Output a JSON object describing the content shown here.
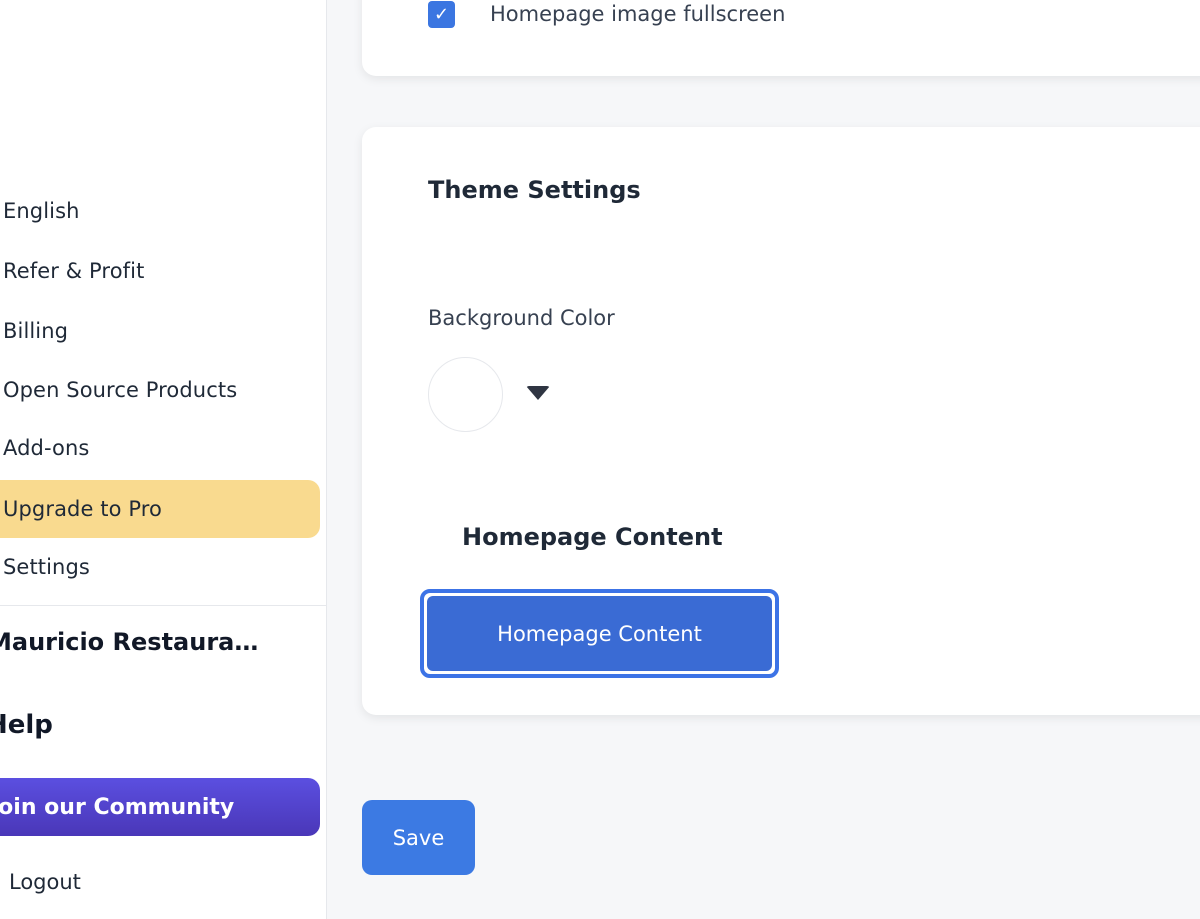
{
  "sidebar": {
    "items": [
      {
        "label": "English"
      },
      {
        "label": "Refer & Profit"
      },
      {
        "label": "Billing"
      },
      {
        "label": "Open Source Products"
      },
      {
        "label": "Add-ons"
      },
      {
        "label": "Upgrade to Pro"
      },
      {
        "label": "Settings"
      }
    ],
    "workspace_name": "Mauricio Restaura…",
    "help_title": "Help",
    "community_label": "Join our Community",
    "logout_label": "Logout",
    "highlight_color": "#f9da8f",
    "community_color": "#5b4fe0"
  },
  "main": {
    "fullscreen_option": {
      "label": "Homepage image fullscreen",
      "checked": true
    },
    "theme_settings": {
      "title": "Theme Settings",
      "background_color_label": "Background Color",
      "background_color_value": "#ffffff",
      "homepage_content_title": "Homepage Content",
      "homepage_content_button": "Homepage Content"
    },
    "save_label": "Save",
    "accent_color": "#3c7ae3"
  }
}
